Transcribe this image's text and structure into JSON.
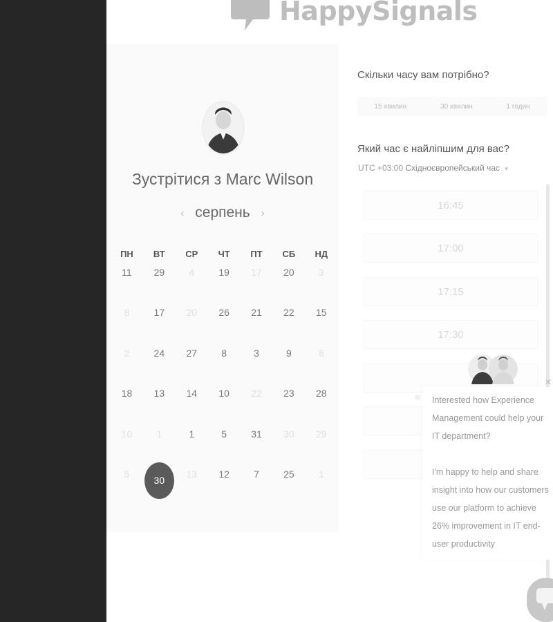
{
  "brand": {
    "name": "HappySignals"
  },
  "booking": {
    "meet_prefix": "Зустрітися з",
    "person_name": "Marc Wilson",
    "month": "серпень",
    "prev_month_icon": "‹",
    "next_month_icon": "›",
    "weekdays": [
      "ПН",
      "ВТ",
      "СР",
      "ЧТ",
      "ПТ",
      "СБ",
      "НД"
    ],
    "days": [
      {
        "label": "11",
        "state": "available"
      },
      {
        "label": "29",
        "state": "available"
      },
      {
        "label": "4",
        "state": "disabled"
      },
      {
        "label": "19",
        "state": "available"
      },
      {
        "label": "17",
        "state": "disabled"
      },
      {
        "label": "20",
        "state": "available"
      },
      {
        "label": "3",
        "state": "disabled"
      },
      {
        "label": "8",
        "state": "disabled"
      },
      {
        "label": "17",
        "state": "available"
      },
      {
        "label": "20",
        "state": "disabled"
      },
      {
        "label": "26",
        "state": "available"
      },
      {
        "label": "21",
        "state": "available"
      },
      {
        "label": "22",
        "state": "available"
      },
      {
        "label": "15",
        "state": "available"
      },
      {
        "label": "2",
        "state": "disabled"
      },
      {
        "label": "24",
        "state": "available"
      },
      {
        "label": "27",
        "state": "available"
      },
      {
        "label": "8",
        "state": "available"
      },
      {
        "label": "3",
        "state": "available"
      },
      {
        "label": "9",
        "state": "available"
      },
      {
        "label": "8",
        "state": "disabled"
      },
      {
        "label": "18",
        "state": "available"
      },
      {
        "label": "13",
        "state": "available"
      },
      {
        "label": "14",
        "state": "available"
      },
      {
        "label": "10",
        "state": "available"
      },
      {
        "label": "22",
        "state": "disabled"
      },
      {
        "label": "23",
        "state": "available"
      },
      {
        "label": "28",
        "state": "available"
      },
      {
        "label": "10",
        "state": "disabled"
      },
      {
        "label": "1",
        "state": "disabled"
      },
      {
        "label": "1",
        "state": "available"
      },
      {
        "label": "5",
        "state": "available"
      },
      {
        "label": "31",
        "state": "available"
      },
      {
        "label": "30",
        "state": "disabled"
      },
      {
        "label": "29",
        "state": "disabled"
      },
      {
        "label": "5",
        "state": "disabled"
      },
      {
        "label": "30",
        "state": "selected"
      },
      {
        "label": "13",
        "state": "disabled"
      },
      {
        "label": "12",
        "state": "available"
      },
      {
        "label": "7",
        "state": "available"
      },
      {
        "label": "25",
        "state": "available"
      },
      {
        "label": "1",
        "state": "disabled"
      }
    ]
  },
  "duration": {
    "question": "Скільки часу вам потрібно?",
    "options": [
      "15 хвилин",
      "30 хвилин",
      "1 годин"
    ]
  },
  "time": {
    "question": "Який час є найліпшим для вас?",
    "tz_offset": "UTC +03:00",
    "tz_name": "Східноєвропейський час",
    "tz_caret": "▾",
    "slots": [
      "16:45",
      "17:00",
      "17:15",
      "17:30",
      "",
      "",
      ""
    ]
  },
  "chat": {
    "message_1": "Interested how Experience Management could help your IT department?",
    "message_2": "I'm happy to help and share insight into how our customers use our platform to achieve 26% improvement in IT end-user productivity",
    "close_icon": "×"
  }
}
